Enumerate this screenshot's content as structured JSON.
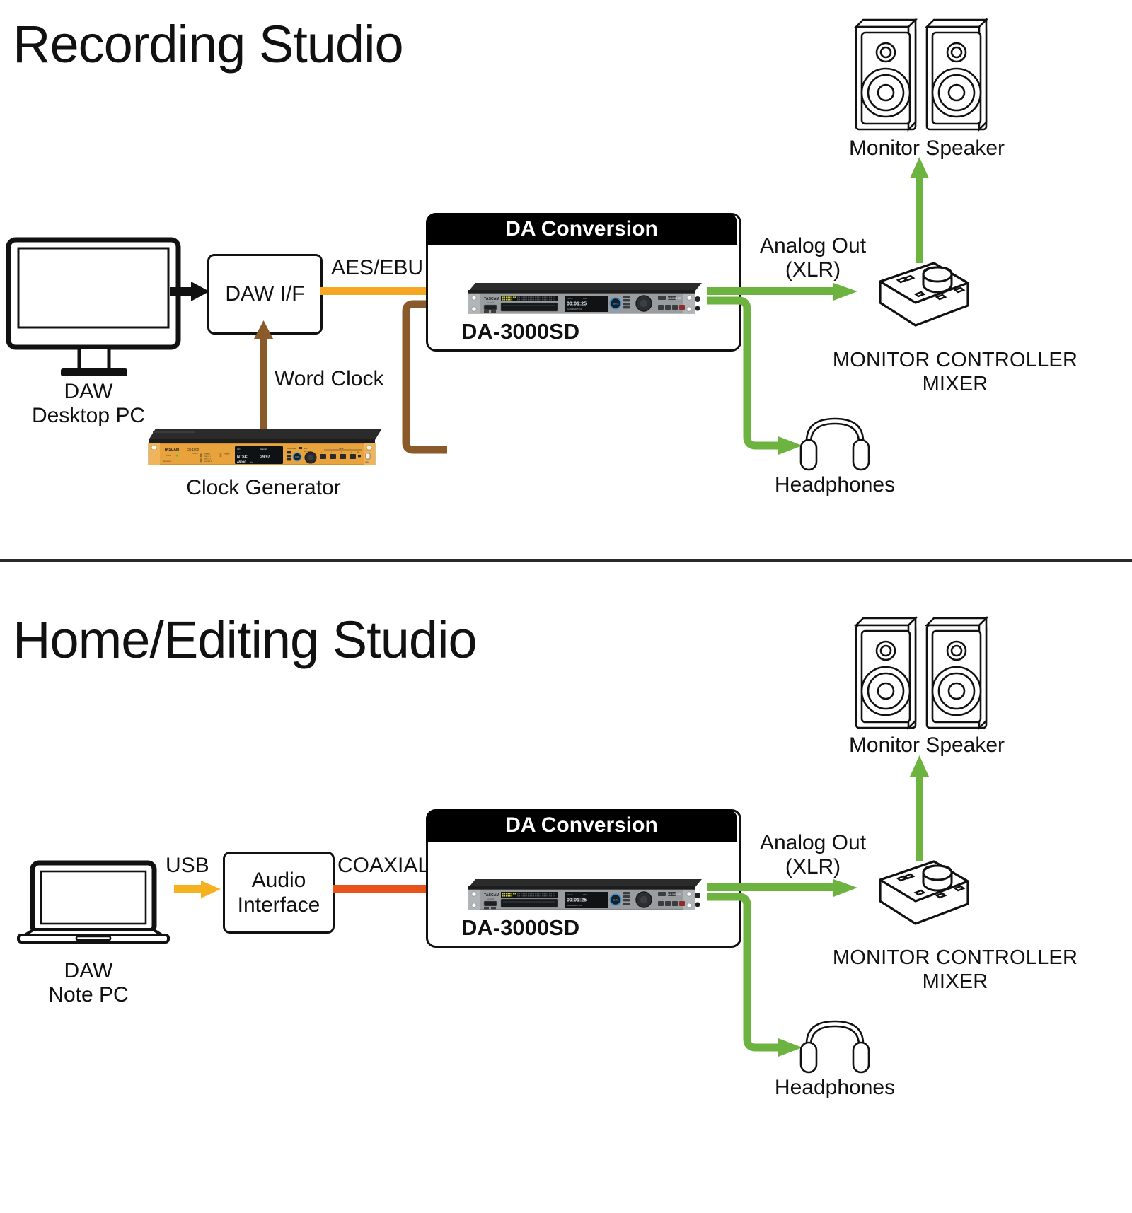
{
  "sections": [
    {
      "id": "recording-studio",
      "title": "Recording Studio",
      "computer_label_line1": "DAW",
      "computer_label_line2": "Desktop PC",
      "interface_label": "DAW I/F",
      "link_to_device_label": "AES/EBU",
      "clock_link_label": "Word Clock",
      "clock_device_label": "Clock Generator",
      "group_header": "DA Conversion",
      "device_label": "DA-3000SD",
      "analog_out_line1": "Analog Out",
      "analog_out_line2": "(XLR)",
      "monitor_controller_line1": "MONITOR CONTROLLER",
      "monitor_controller_line2": "MIXER",
      "speaker_label": "Monitor Speaker",
      "headphones_label": "Headphones",
      "device_brand": "TASCAM",
      "device_model_right": "DA-3000SD",
      "device_model_sub": "Master Recorder",
      "device_time": "00:01:25",
      "device_file": "DA3000SD-T001"
    },
    {
      "id": "home-editing-studio",
      "title": "Home/Editing Studio",
      "computer_label_line1": "DAW",
      "computer_label_line2": "Note PC",
      "interface_label_line1": "Audio",
      "interface_label_line2": "Interface",
      "usb_label": "USB",
      "coaxial_label": "COAXIAL",
      "group_header": "DA Conversion",
      "device_label": "DA-3000SD",
      "analog_out_line1": "Analog Out",
      "analog_out_line2": "(XLR)",
      "monitor_controller_line1": "MONITOR CONTROLLER",
      "monitor_controller_line2": "MIXER",
      "speaker_label": "Monitor Speaker",
      "headphones_label": "Headphones",
      "device_brand": "TASCAM",
      "device_model_right": "DA-3000SD",
      "device_model_sub": "Master Recorder",
      "device_time": "00:01:25",
      "device_file": "DA3000SD-T001"
    }
  ],
  "clock_generator": {
    "brand": "TASCAM",
    "model": "CG-1000",
    "display_source": "Internal",
    "display_format": "NTSC",
    "display_rate": "29.97",
    "display_freq": "48000",
    "display_freq_unit": "Hz",
    "knob_label": "MULTI JOG"
  },
  "colors": {
    "black": "#111111",
    "aes_orange": "#F5A623",
    "usb_orange": "#F5B21E",
    "coaxial_red": "#E8521B",
    "word_clock_brown": "#8B5A2B",
    "analog_green": "#6CB33F",
    "group_header_bg": "#000000",
    "device_face": "#9a9da0",
    "clock_face": "#E8A33D"
  },
  "icons": {
    "desktop": "desktop-monitor-icon",
    "laptop": "laptop-icon",
    "speaker": "studio-monitor-speaker-icon",
    "headphones": "headphones-icon",
    "monitor_controller": "monitor-controller-box-icon",
    "rack_unit": "rack-unit-icon"
  }
}
